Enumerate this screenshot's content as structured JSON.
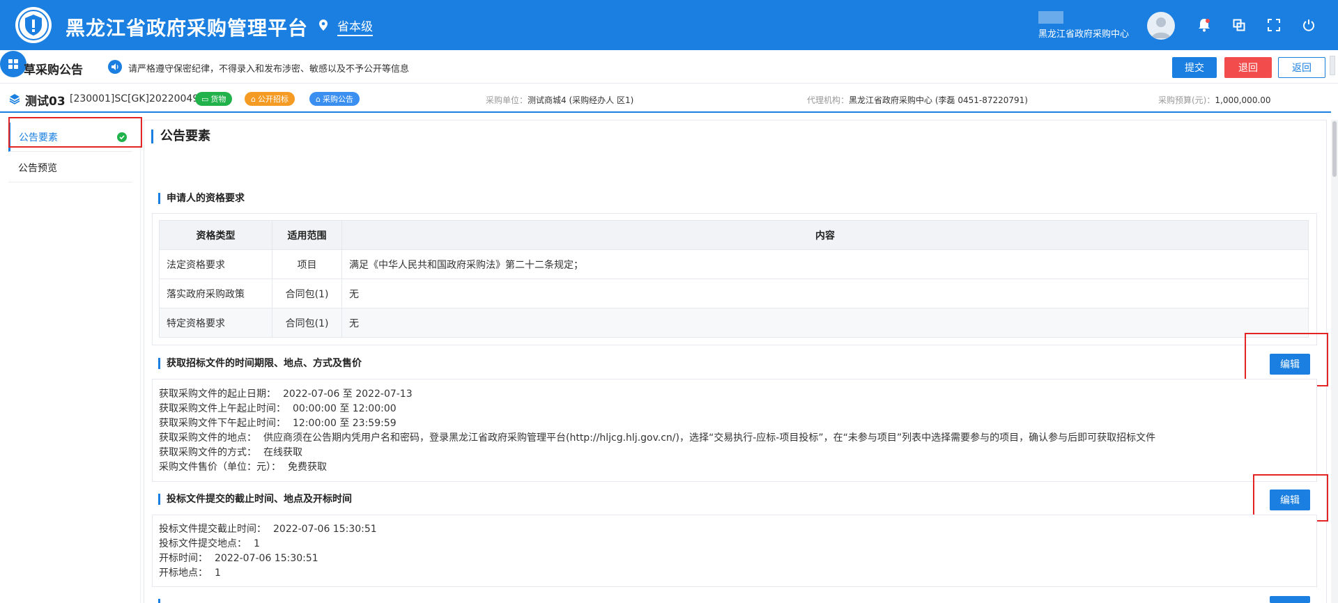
{
  "header": {
    "app_title": "黑龙江省政府采购管理平台",
    "region": "省本级",
    "user_org": "黑龙江省政府采购中心",
    "icons": [
      "bell-icon",
      "window-icon",
      "fullscreen-icon",
      "power-icon"
    ]
  },
  "notice_bar": {
    "page_title": "草采购公告",
    "notice": "请严格遵守保密纪律，不得录入和发布涉密、敏感以及不予公开等信息",
    "submit_label": "提交",
    "reject_label": "退回",
    "back_label": "返回"
  },
  "project": {
    "name": "测试03",
    "code": "[230001]SC[GK]20220049",
    "tags": [
      "货物",
      "公开招标",
      "采购公告"
    ],
    "buyer_key": "采购单位：",
    "buyer_value": "测试商城4 (采购经办人 区1)",
    "agency_key": "代理机构：",
    "agency_value": "黑龙江省政府采购中心 (李磊 0451-87220791)",
    "budget_key": "采购预算(元)：",
    "budget_value": "1,000,000.00"
  },
  "sidebar": {
    "items": [
      {
        "label": "公告要素"
      },
      {
        "label": "公告预览"
      }
    ]
  },
  "main": {
    "title": "公告要素",
    "edit_label": "编辑",
    "qualification": {
      "title": "申请人的资格要求",
      "columns": [
        "资格类型",
        "适用范围",
        "内容"
      ],
      "rows": [
        {
          "type": "法定资格要求",
          "scope": "项目",
          "content": "满足《中华人民共和国政府采购法》第二十二条规定；"
        },
        {
          "type": "落实政府采购政策",
          "scope": "合同包(1)",
          "content": "无"
        },
        {
          "type": "特定资格要求",
          "scope": "合同包(1)",
          "content": "无"
        }
      ]
    },
    "obtain": {
      "title": "获取招标文件的时间期限、地点、方式及售价",
      "lines": [
        {
          "k": "获取采购文件的起止日期：",
          "v": "2022-07-06 至 2022-07-13"
        },
        {
          "k": "获取采购文件上午起止时间：",
          "v": "00:00:00 至 12:00:00"
        },
        {
          "k": "获取采购文件下午起止时间：",
          "v": "12:00:00 至 23:59:59"
        },
        {
          "k": "获取采购文件的地点：",
          "v": "供应商须在公告期内凭用户名和密码，登录黑龙江省政府采购管理平台(http://hljcg.hlj.gov.cn/)，选择“交易执行-应标-项目投标”，在“未参与项目”列表中选择需要参与的项目，确认参与后即可获取招标文件"
        },
        {
          "k": "获取采购文件的方式：",
          "v": "在线获取"
        },
        {
          "k": "采购文件售价（单位：元）：",
          "v": "免费获取"
        }
      ]
    },
    "submission": {
      "title": "投标文件提交的截止时间、地点及开标时间",
      "lines": [
        {
          "k": "投标文件提交截止时间：",
          "v": "2022-07-06 15:30:51"
        },
        {
          "k": "投标文件提交地点：",
          "v": "1"
        },
        {
          "k": "开标时间：",
          "v": "2022-07-06 15:30:51"
        },
        {
          "k": "开标地点：",
          "v": "1"
        }
      ]
    }
  },
  "colors": {
    "primary": "#1a7fe0",
    "danger": "#f24c4c",
    "success": "#22b24c",
    "warning": "#f59a23",
    "highlight": "#e22424"
  }
}
